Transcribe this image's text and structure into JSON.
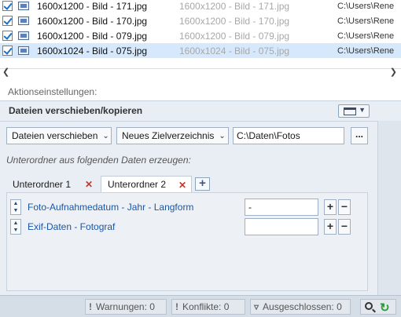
{
  "files": [
    {
      "name": "1600x1200 - Bild - 171.jpg",
      "preview": "1600x1200 - Bild - 171.jpg",
      "path": "C:\\Users\\Rene",
      "selected": false
    },
    {
      "name": "1600x1200 - Bild - 170.jpg",
      "preview": "1600x1200 - Bild - 170.jpg",
      "path": "C:\\Users\\Rene",
      "selected": false
    },
    {
      "name": "1600x1200 - Bild - 079.jpg",
      "preview": "1600x1200 - Bild - 079.jpg",
      "path": "C:\\Users\\Rene",
      "selected": false
    },
    {
      "name": "1600x1024 - Bild - 075.jpg",
      "preview": "1600x1024 - Bild - 075.jpg",
      "path": "C:\\Users\\Rene",
      "selected": true
    }
  ],
  "aktion_label": "Aktionseinstellungen:",
  "panel": {
    "title": "Dateien verschieben/kopieren",
    "move_dropdown": "Dateien verschieben",
    "target_dropdown": "Neues Zielverzeichnis",
    "target_path": "C:\\Daten\\Fotos",
    "more_label": "...",
    "subfolder_hint": "Unterordner aus folgenden Daten erzeugen:",
    "tabs": [
      {
        "label": "Unterordner 1",
        "active": false
      },
      {
        "label": "Unterordner 2",
        "active": true
      }
    ],
    "rows": [
      {
        "label": "Foto-Aufnahmedatum - Jahr - Langform",
        "value": "-"
      },
      {
        "label": "Exif-Daten - Fotograf",
        "value": ""
      }
    ]
  },
  "status": {
    "warnings": "Warnungen: 0",
    "conflicts": "Konflikte: 0",
    "excluded": "Ausgeschlossen: 0"
  },
  "colors": {
    "selection": "#d6e8fb",
    "panel_bg": "#e9eef4",
    "link_blue": "#1a56a6",
    "close_red": "#c0392b"
  }
}
